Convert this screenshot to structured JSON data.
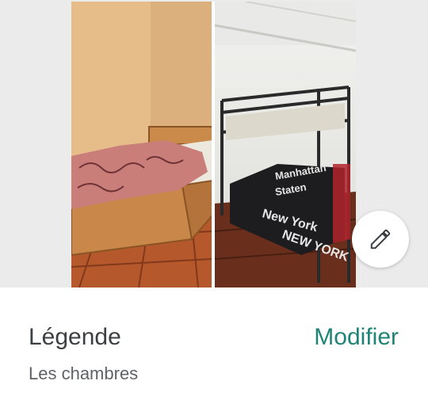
{
  "photo": {
    "description_icon": "photo-collage"
  },
  "edit_button": {
    "icon": "pencil-icon"
  },
  "caption": {
    "label": "Légende",
    "modify_label": "Modifier",
    "value": "Les chambres"
  },
  "colors": {
    "accent": "#1f8476",
    "label_text": "#3c4043",
    "secondary_text": "#5f6368",
    "background": "#ffffff",
    "strip_background": "#ebebeb"
  }
}
